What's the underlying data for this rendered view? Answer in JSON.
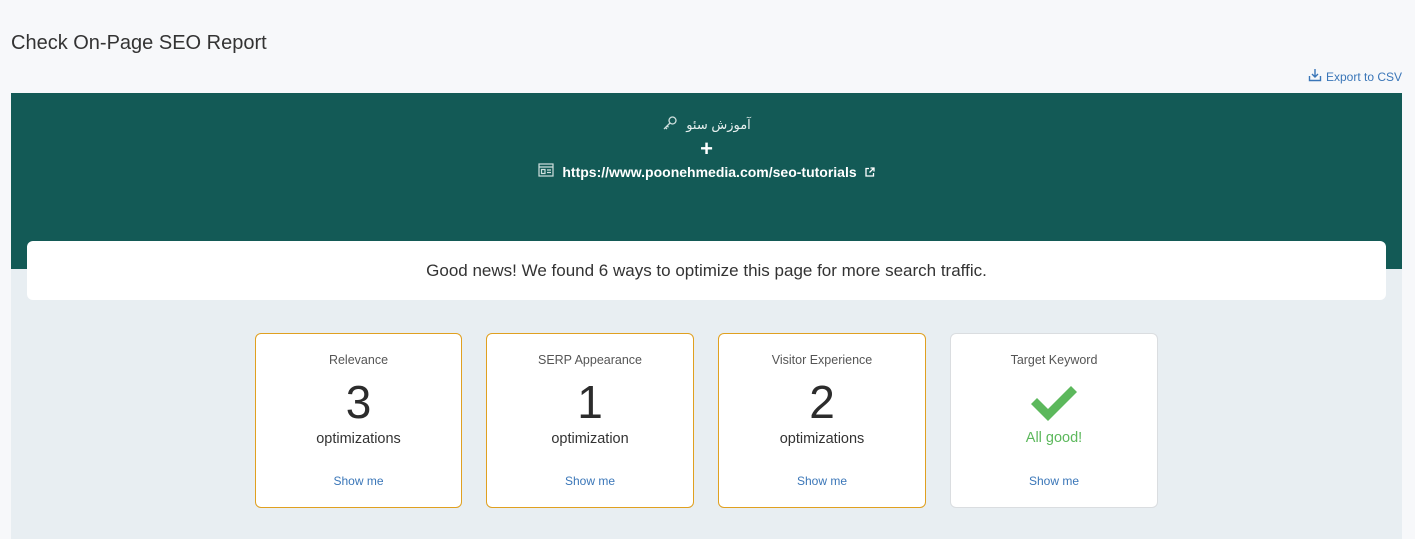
{
  "page": {
    "title": "Check On-Page SEO Report",
    "export_label": "Export to CSV"
  },
  "banner": {
    "keyword": "آموزش سئو",
    "plus": "+",
    "url": "https://www.poonehmedia.com/seo-tutorials",
    "background_color": "#135a56"
  },
  "summary": {
    "message": "Good news! We found 6 ways to optimize this page for more search traffic."
  },
  "cards": [
    {
      "label": "Relevance",
      "count": "3",
      "unit": "optimizations",
      "link": "Show me"
    },
    {
      "label": "SERP Appearance",
      "count": "1",
      "unit": "optimization",
      "link": "Show me"
    },
    {
      "label": "Visitor Experience",
      "count": "2",
      "unit": "optimizations",
      "link": "Show me"
    },
    {
      "label": "Target Keyword",
      "status": "All good!",
      "icon": "check-icon",
      "link": "Show me"
    }
  ],
  "colors": {
    "accent_border": "#e0a020",
    "link": "#3a76b8",
    "success": "#5cb85c"
  }
}
